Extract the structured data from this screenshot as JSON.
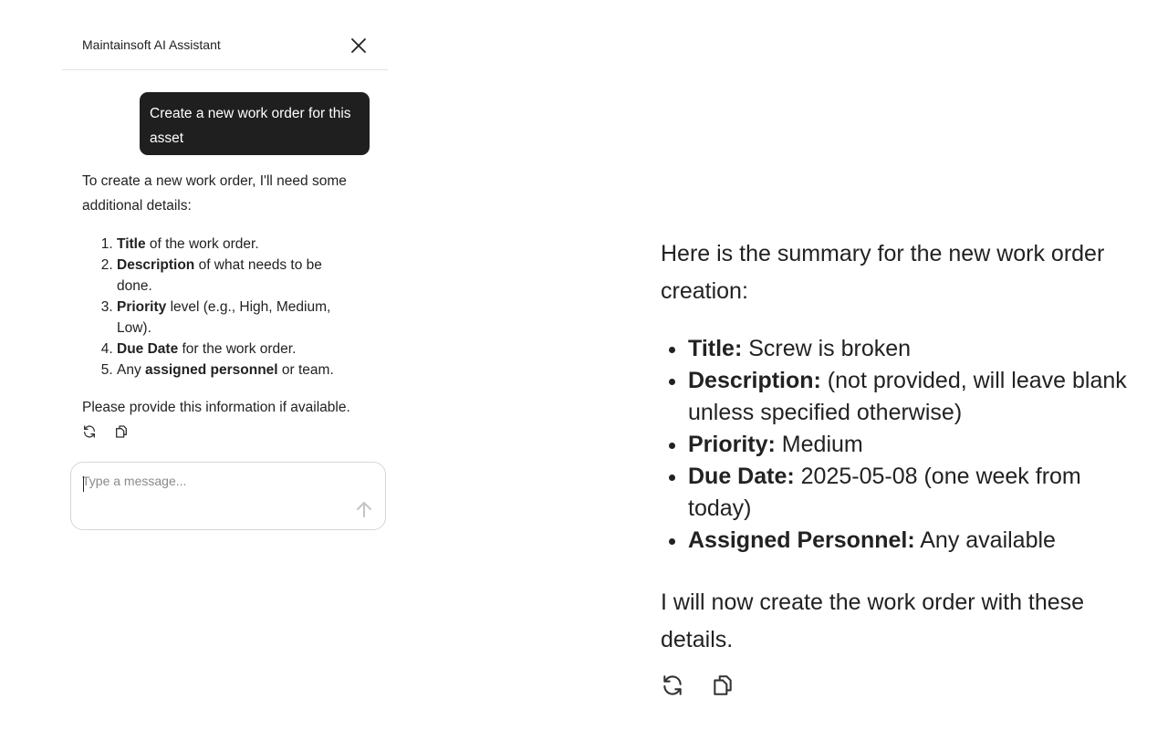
{
  "widget": {
    "title": "Maintainsoft AI Assistant",
    "close_icon": "close-icon"
  },
  "conversation": {
    "user_message": "Create a new work order for this asset",
    "assistant_intro": "To create a new work order, I'll need some additional details:",
    "details_list": [
      {
        "bold": "Title",
        "rest": " of the work order."
      },
      {
        "bold": "Description",
        "rest": " of what needs to be done."
      },
      {
        "bold": "Priority",
        "rest": " level (e.g., High, Medium, Low)."
      },
      {
        "bold": "Due Date",
        "rest": " for the work order."
      },
      {
        "pre": "Any ",
        "bold": "assigned personnel",
        "rest": " or team."
      }
    ],
    "assistant_outro": "Please provide this information if available.",
    "actions": [
      "refresh-icon",
      "copy-icon"
    ]
  },
  "composer": {
    "placeholder": "Type a message...",
    "send_icon": "arrow-up-icon"
  },
  "summary_message": {
    "intro": "Here is the summary for the new work order creation:",
    "items": [
      {
        "label": "Title:",
        "value": " Screw is broken"
      },
      {
        "label": "Description:",
        "value": " (not provided, will leave blank unless specified otherwise)"
      },
      {
        "label": "Priority:",
        "value": " Medium"
      },
      {
        "label": "Due Date:",
        "value": " 2025-05-08 (one week from today)"
      },
      {
        "label": "Assigned Personnel:",
        "value": " Any available"
      }
    ],
    "outro": "I will now create the work order with these details.",
    "actions": [
      "refresh-icon",
      "copy-icon"
    ]
  }
}
